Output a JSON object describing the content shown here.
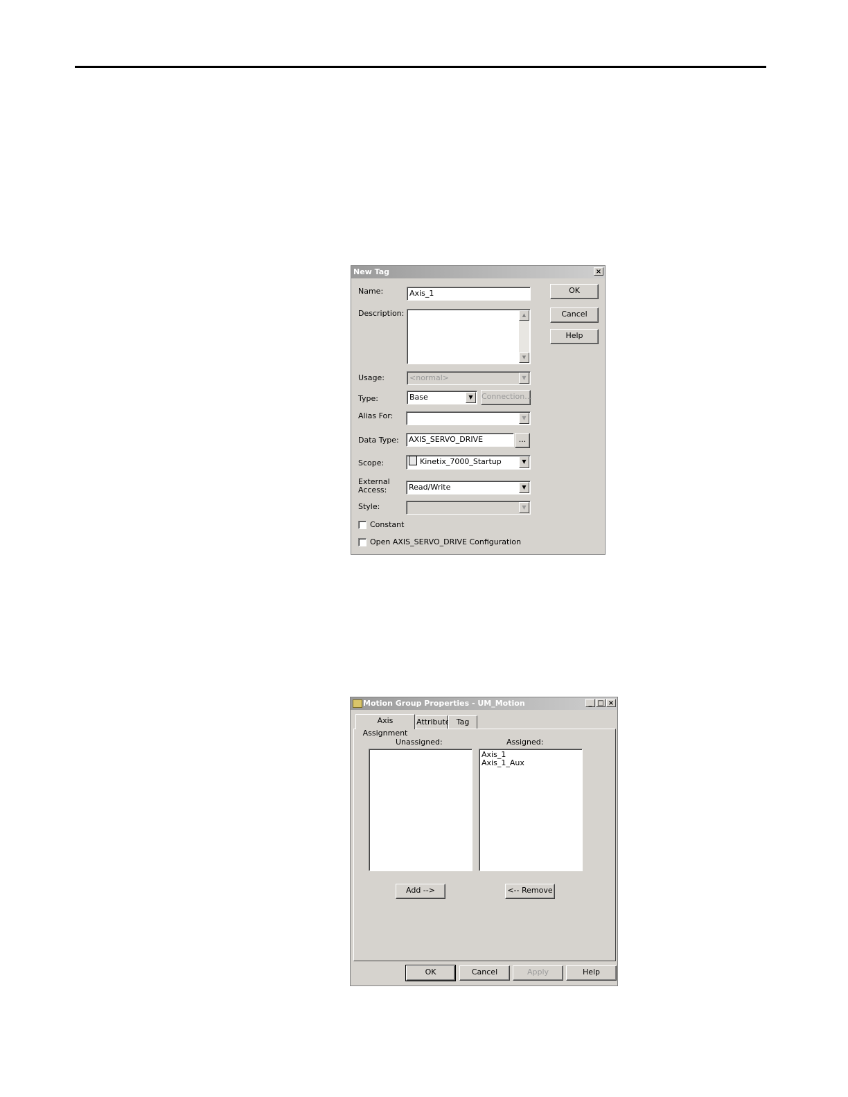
{
  "new_tag": {
    "title": "New Tag",
    "close_glyph": "×",
    "name_label": "Name:",
    "name_value": "Axis_1",
    "description_label": "Description:",
    "description_value": "",
    "usage_label": "Usage:",
    "usage_value": "<normal>",
    "type_label": "Type:",
    "type_value": "Base",
    "connection_label": "Connection...",
    "alias_label": "Alias For:",
    "alias_value": "",
    "datatype_label": "Data Type:",
    "datatype_value": "AXIS_SERVO_DRIVE",
    "browse_label": "...",
    "scope_label": "Scope:",
    "scope_value": "Kinetix_7000_Startup",
    "external_access_label_1": "External",
    "external_access_label_2": "Access:",
    "external_access_value": "Read/Write",
    "style_label": "Style:",
    "style_value": "",
    "constant_label": "Constant",
    "open_config_label": "Open AXIS_SERVO_DRIVE Configuration",
    "ok_label": "OK",
    "cancel_label": "Cancel",
    "help_label": "Help"
  },
  "motion_group": {
    "title": "Motion Group Properties - UM_Motion",
    "tabs": [
      "Axis Assignment",
      "Attribute",
      "Tag"
    ],
    "unassigned_label": "Unassigned:",
    "assigned_label": "Assigned:",
    "unassigned_items": [],
    "assigned_items": [
      "Axis_1",
      "Axis_1_Aux"
    ],
    "add_label": "Add -->",
    "remove_label": "<-- Remove",
    "ok_label": "OK",
    "cancel_label": "Cancel",
    "apply_label": "Apply",
    "help_label": "Help",
    "minimize_glyph": "_",
    "maximize_glyph": "□",
    "close_glyph": "×"
  }
}
